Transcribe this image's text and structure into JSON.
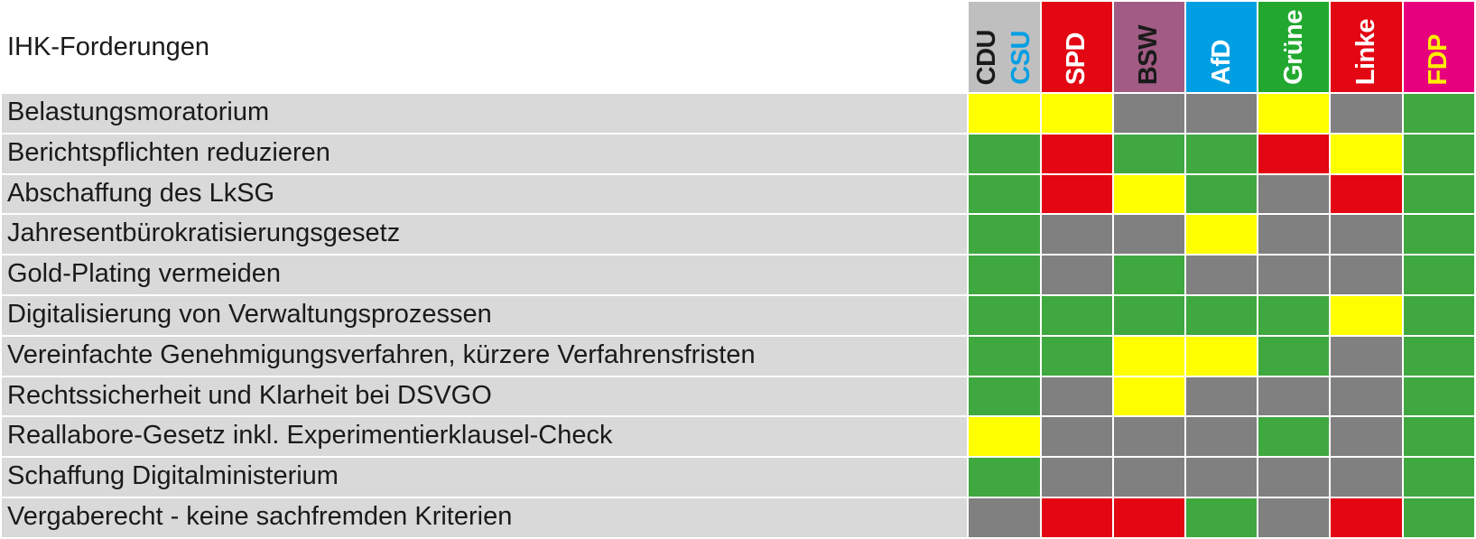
{
  "title": "IHK-Forderungen",
  "parties": [
    {
      "id": "cdu",
      "bg": "p-cdu",
      "lines": [
        {
          "text": "CDU",
          "color": "#1a1a1a"
        },
        {
          "text": "CSU",
          "color": "#009fe3"
        }
      ]
    },
    {
      "id": "spd",
      "bg": "p-spd",
      "lines": [
        {
          "text": "SPD",
          "color": "#ffffff"
        }
      ]
    },
    {
      "id": "bsw",
      "bg": "p-bsw",
      "lines": [
        {
          "text": "BSW",
          "color": "#1a1a1a"
        }
      ]
    },
    {
      "id": "afd",
      "bg": "p-afd",
      "lines": [
        {
          "text": "AfD",
          "color": "#ffffff"
        }
      ]
    },
    {
      "id": "gruene",
      "bg": "p-gruene",
      "lines": [
        {
          "text": "Grüne",
          "color": "#ffffff"
        }
      ]
    },
    {
      "id": "linke",
      "bg": "p-linke",
      "lines": [
        {
          "text": "Linke",
          "color": "#ffffff"
        }
      ]
    },
    {
      "id": "fdp",
      "bg": "p-fdp",
      "lines": [
        {
          "text": "FDP",
          "color": "#ffed00"
        }
      ]
    }
  ],
  "rows": [
    {
      "topic": "Belastungsmoratorium",
      "cells": [
        "yellow",
        "yellow",
        "grey",
        "grey",
        "yellow",
        "grey",
        "green"
      ]
    },
    {
      "topic": "Berichtspflichten reduzieren",
      "cells": [
        "green",
        "red",
        "green",
        "green",
        "red",
        "yellow",
        "green"
      ]
    },
    {
      "topic": "Abschaffung des LkSG",
      "cells": [
        "green",
        "red",
        "yellow",
        "green",
        "grey",
        "red",
        "green"
      ]
    },
    {
      "topic": "Jahresentbürokratisierungsgesetz",
      "cells": [
        "green",
        "grey",
        "grey",
        "yellow",
        "grey",
        "grey",
        "green"
      ]
    },
    {
      "topic": "Gold-Plating vermeiden",
      "cells": [
        "green",
        "grey",
        "green",
        "grey",
        "grey",
        "grey",
        "green"
      ]
    },
    {
      "topic": "Digitalisierung von Verwaltungsprozessen",
      "cells": [
        "green",
        "green",
        "green",
        "green",
        "green",
        "yellow",
        "green"
      ]
    },
    {
      "topic": "Vereinfachte Genehmigungsverfahren, kürzere Verfahrensfristen",
      "cells": [
        "green",
        "green",
        "yellow",
        "yellow",
        "green",
        "grey",
        "green"
      ]
    },
    {
      "topic": "Rechtssicherheit und Klarheit bei DSVGO",
      "cells": [
        "green",
        "grey",
        "yellow",
        "grey",
        "grey",
        "grey",
        "green"
      ]
    },
    {
      "topic": "Reallabore-Gesetz inkl. Experimentierklausel-Check",
      "cells": [
        "yellow",
        "grey",
        "grey",
        "grey",
        "green",
        "grey",
        "green"
      ]
    },
    {
      "topic": "Schaffung Digitalministerium",
      "cells": [
        "green",
        "grey",
        "grey",
        "grey",
        "grey",
        "grey",
        "green"
      ]
    },
    {
      "topic": "Vergaberecht - keine sachfremden Kriterien",
      "cells": [
        "grey",
        "red",
        "red",
        "green",
        "grey",
        "red",
        "green"
      ]
    }
  ],
  "status_colors": {
    "green": "#3fa83f",
    "yellow": "#ffff00",
    "red": "#e30613",
    "grey": "#808080"
  },
  "chart_data": {
    "type": "heatmap",
    "title": "IHK-Forderungen",
    "x_categories": [
      "CDU/CSU",
      "SPD",
      "BSW",
      "AfD",
      "Grüne",
      "Linke",
      "FDP"
    ],
    "y_categories": [
      "Belastungsmoratorium",
      "Berichtspflichten reduzieren",
      "Abschaffung des LkSG",
      "Jahresentbürokratisierungsgesetz",
      "Gold-Plating vermeiden",
      "Digitalisierung von Verwaltungsprozessen",
      "Vereinfachte Genehmigungsverfahren, kürzere Verfahrensfristen",
      "Rechtssicherheit und Klarheit bei DSVGO",
      "Reallabore-Gesetz inkl. Experimentierklausel-Check",
      "Schaffung Digitalministerium",
      "Vergaberecht - keine sachfremden Kriterien"
    ],
    "value_levels": [
      "green",
      "yellow",
      "grey",
      "red"
    ],
    "values": [
      [
        "yellow",
        "yellow",
        "grey",
        "grey",
        "yellow",
        "grey",
        "green"
      ],
      [
        "green",
        "red",
        "green",
        "green",
        "red",
        "yellow",
        "green"
      ],
      [
        "green",
        "red",
        "yellow",
        "green",
        "grey",
        "red",
        "green"
      ],
      [
        "green",
        "grey",
        "grey",
        "yellow",
        "grey",
        "grey",
        "green"
      ],
      [
        "green",
        "grey",
        "green",
        "grey",
        "grey",
        "grey",
        "green"
      ],
      [
        "green",
        "green",
        "green",
        "green",
        "green",
        "yellow",
        "green"
      ],
      [
        "green",
        "green",
        "yellow",
        "yellow",
        "green",
        "grey",
        "green"
      ],
      [
        "green",
        "grey",
        "yellow",
        "grey",
        "grey",
        "grey",
        "green"
      ],
      [
        "yellow",
        "grey",
        "grey",
        "grey",
        "green",
        "grey",
        "green"
      ],
      [
        "green",
        "grey",
        "grey",
        "grey",
        "grey",
        "grey",
        "green"
      ],
      [
        "grey",
        "red",
        "red",
        "green",
        "grey",
        "red",
        "green"
      ]
    ]
  }
}
